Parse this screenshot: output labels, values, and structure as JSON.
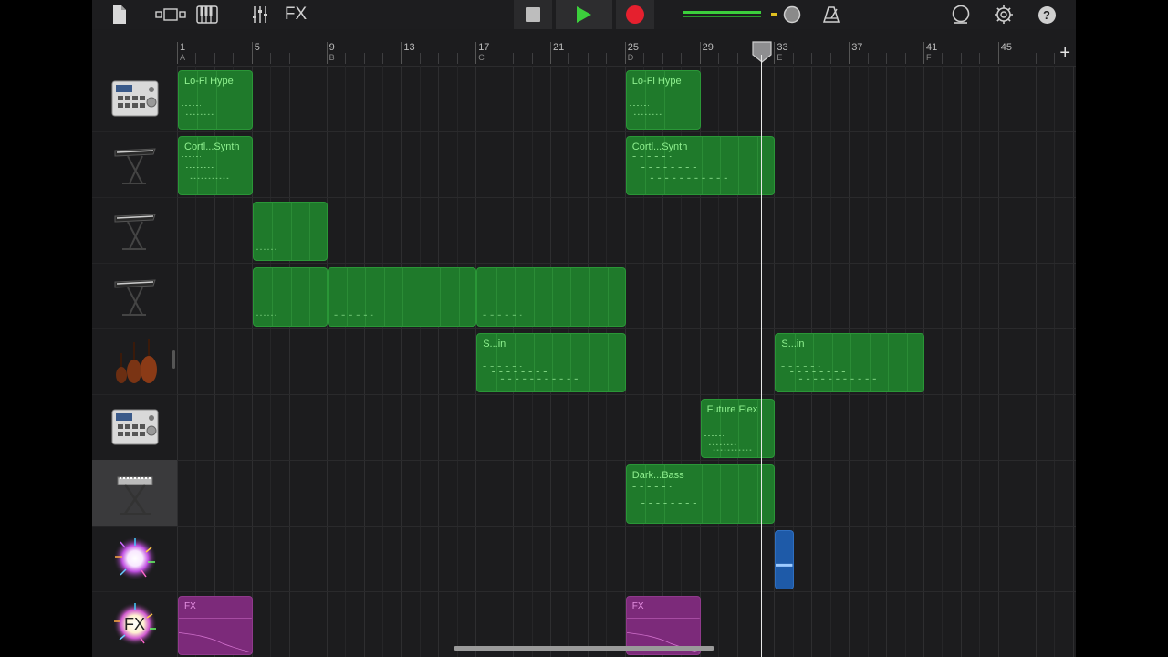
{
  "toolbar": {
    "fx_label": "FX",
    "icons": [
      "document-icon",
      "track-view-icon",
      "keyboard-icon",
      "mixer-icon",
      "stop-icon",
      "play-icon",
      "record-icon",
      "master-volume-slider",
      "metronome-icon",
      "loop-browser-icon",
      "settings-icon",
      "help-icon"
    ],
    "help_label": "?"
  },
  "ruler": {
    "bars": [
      "1",
      "5",
      "9",
      "13",
      "17",
      "21",
      "25",
      "29",
      "33",
      "37",
      "41",
      "45"
    ],
    "markers": [
      "A",
      "B",
      "C",
      "D",
      "E",
      "F"
    ],
    "add_label": "+"
  },
  "tracks": [
    {
      "instrument": "drum-machine-icon",
      "regions": [
        {
          "label": "Lo-Fi Hype"
        },
        {
          "label": "Lo-Fi Hype"
        }
      ]
    },
    {
      "instrument": "keyboard-synth-icon",
      "regions": [
        {
          "label": "Cortl...Synth"
        },
        {
          "label": "Cortl...Synth"
        }
      ]
    },
    {
      "instrument": "keyboard-synth-icon",
      "regions": [
        {
          "label": ""
        }
      ]
    },
    {
      "instrument": "keyboard-synth-icon",
      "regions": [
        {
          "label": ""
        },
        {
          "label": ""
        },
        {
          "label": ""
        }
      ]
    },
    {
      "instrument": "strings-icon",
      "regions": [
        {
          "label": "S...in"
        },
        {
          "label": "S...in"
        }
      ]
    },
    {
      "instrument": "drum-machine-icon",
      "regions": [
        {
          "label": "Future Flex"
        }
      ]
    },
    {
      "instrument": "keyboard-stand-icon",
      "selected": true,
      "regions": [
        {
          "label": "Dark...Bass"
        }
      ]
    },
    {
      "instrument": "sparkle-icon",
      "regions": [
        {
          "label": ""
        }
      ]
    },
    {
      "instrument": "fx-sparkle-icon",
      "regions": [
        {
          "label": "FX"
        },
        {
          "label": "FX"
        }
      ]
    }
  ],
  "fx_track_icon_label": "FX",
  "colors": {
    "region_green": "#1f7a2b",
    "region_label": "#8ff08f",
    "region_purple": "#7c2a7a",
    "region_blue": "#1e5aa8",
    "play": "#3ccf3c",
    "record": "#e5202e"
  }
}
